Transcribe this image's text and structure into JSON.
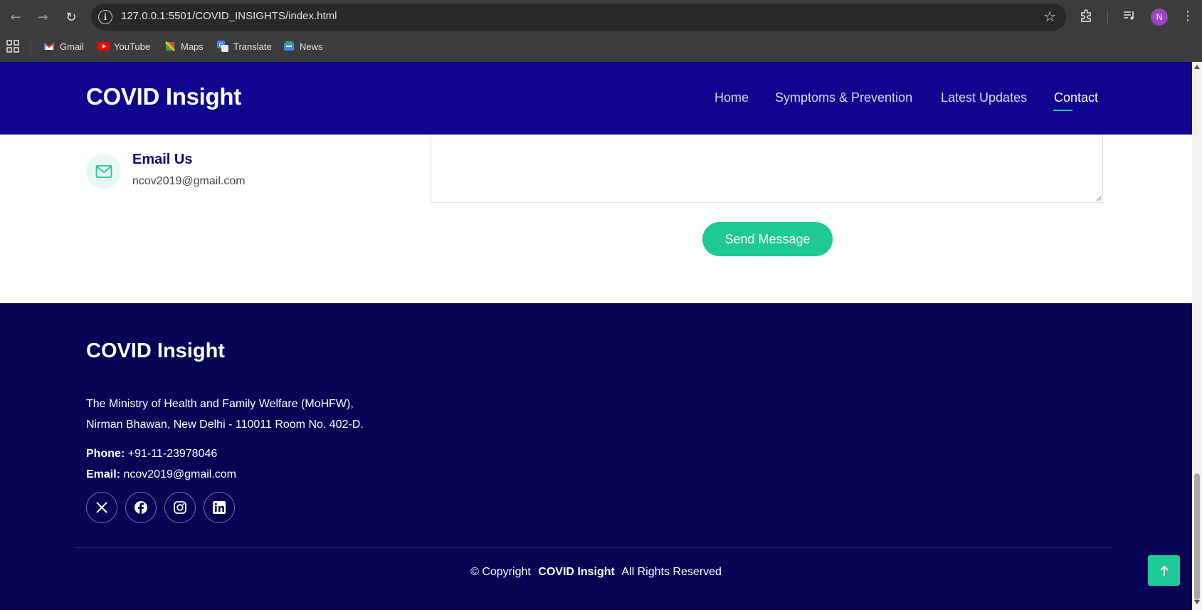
{
  "browser": {
    "url": "127.0.0.1:5501/COVID_INSIGHTS/index.html",
    "profile_initial": "N",
    "bookmarks": [
      {
        "label": "Gmail",
        "icon": "gmail-icon",
        "color": "#ea4335"
      },
      {
        "label": "YouTube",
        "icon": "youtube-icon",
        "color": "#ff0000"
      },
      {
        "label": "Maps",
        "icon": "maps-icon",
        "color": "#34a853"
      },
      {
        "label": "Translate",
        "icon": "translate-icon",
        "color": "#4285f4"
      },
      {
        "label": "News",
        "icon": "news-icon",
        "color": "#4285f4"
      }
    ]
  },
  "header": {
    "logo": "COVID Insight",
    "nav": [
      "Home",
      "Symptoms & Prevention",
      "Latest Updates",
      "Contact"
    ],
    "active_nav": "Contact"
  },
  "contact": {
    "email_title": "Email Us",
    "email_value": "ncov2019@gmail.com",
    "send_button": "Send Message"
  },
  "footer": {
    "logo": "COVID Insight",
    "address_line1": "The Ministry of Health and Family Welfare (MoHFW),",
    "address_line2": "Nirman Bhawan, New Delhi - 110011 Room No. 402-D.",
    "phone_label": "Phone:",
    "phone_value": "+91-11-23978046",
    "email_label": "Email:",
    "email_value": "ncov2019@gmail.com",
    "socials": [
      "x-icon",
      "facebook-icon",
      "instagram-icon",
      "linkedin-icon"
    ],
    "copyright_prefix": "© Copyright",
    "copyright_brand": "COVID Insight",
    "copyright_suffix": "All Rights Reserved"
  },
  "colors": {
    "header_bg": "#10058f",
    "footer_bg": "#070355",
    "accent": "#1ec995"
  }
}
